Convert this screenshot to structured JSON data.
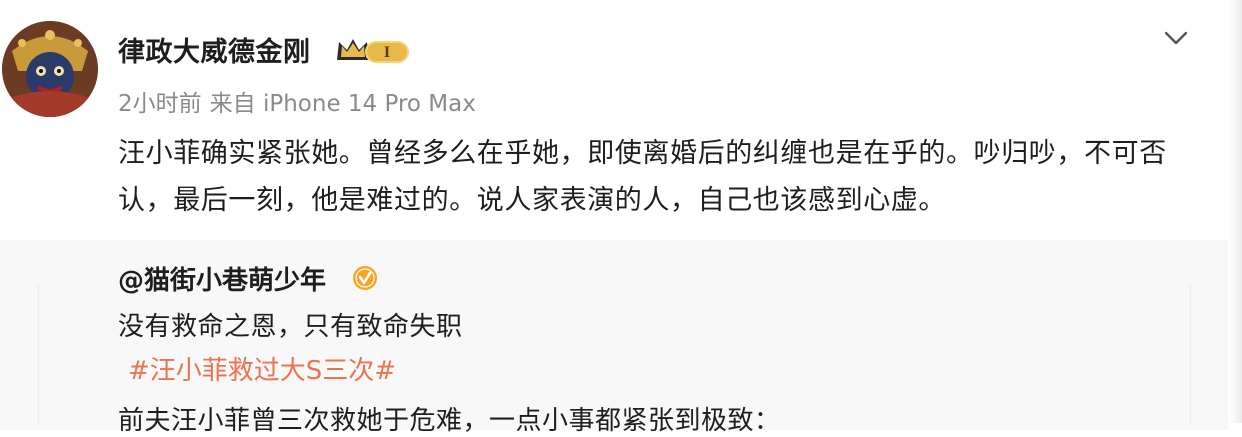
{
  "post": {
    "username": "律政大威德金刚",
    "rank_badge": "I",
    "time": "2小时前",
    "source": "来自 iPhone 14 Pro Max",
    "text": "汪小菲确实紧张她。曾经多么在乎她，即使离婚后的纠缠也是在乎的。吵归吵，不可否认，最后一刻，他是难过的。说人家表演的人，自己也该感到心虚。"
  },
  "quoted": {
    "username": "@猫街小巷萌少年",
    "text": "没有救命之恩，只有致命失职",
    "hashtag": "#汪小菲救过大S三次#",
    "text_cut": "前夫汪小菲曾三次救她于危难，一点小事都紧张到极致："
  },
  "icons": {
    "avatar": "avatar-icon",
    "rank": "crown-rank-icon",
    "expand": "chevron-down-icon",
    "verified": "verified-icon"
  },
  "colors": {
    "hashtag": "#eb7350",
    "meta": "#8a8a8a",
    "badge_gold": "#e8b84a",
    "verified_orange": "#f5a623"
  }
}
